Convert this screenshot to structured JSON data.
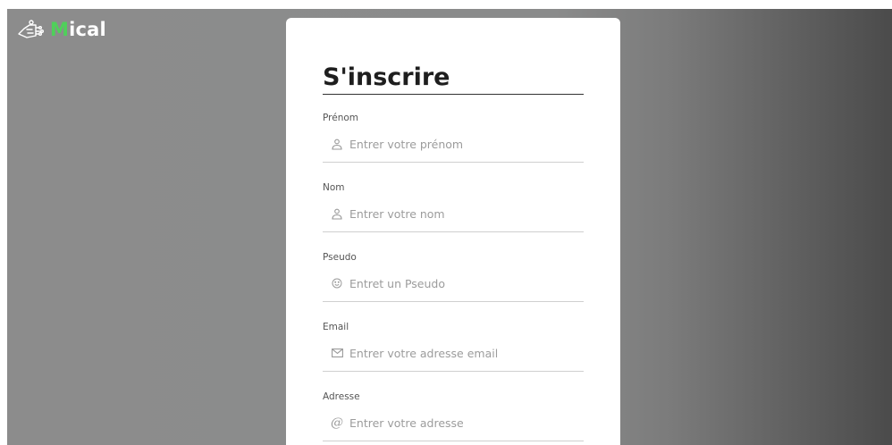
{
  "brand": {
    "logo_letter": "M",
    "logo_rest": "ical",
    "accent_color": "#4fd05a"
  },
  "form": {
    "title": "S'inscrire",
    "fields": [
      {
        "label": "Prénom",
        "placeholder": "Entrer votre prénom",
        "icon": "user-icon"
      },
      {
        "label": "Nom",
        "placeholder": "Entrer votre nom",
        "icon": "user-icon"
      },
      {
        "label": "Pseudo",
        "placeholder": "Entret un Pseudo",
        "icon": "smiley-icon"
      },
      {
        "label": "Email",
        "placeholder": "Entrer votre adresse email",
        "icon": "mail-icon"
      },
      {
        "label": "Adresse",
        "placeholder": "Entrer votre adresse",
        "icon": "at-icon"
      }
    ]
  }
}
